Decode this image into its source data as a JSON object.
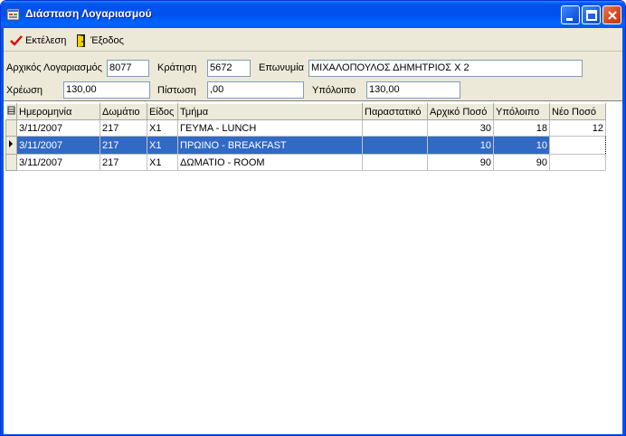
{
  "window": {
    "title": "Διάσπαση Λογαριασμού",
    "colors": {
      "title_bar": "#0054e3",
      "selection": "#316ac5",
      "face": "#ece9d8"
    }
  },
  "toolbar": {
    "execute_label": "Εκτέλεση",
    "exit_label": "Έξοδος"
  },
  "form": {
    "account_label": "Αρχικός Λογαριασμός",
    "account_value": "8077",
    "reservation_label": "Κράτηση",
    "reservation_value": "5672",
    "name_label": "Επωνυμία",
    "name_value": "ΜΙΧΑΛΟΠΟΥΛΟΣ ΔΗΜΗΤΡΙΟΣ Χ 2",
    "debit_label": "Χρέωση",
    "debit_value": "130,00",
    "credit_label": "Πίστωση",
    "credit_value": ",00",
    "balance_label": "Υπόλοιπο",
    "balance_value": "130,00"
  },
  "grid": {
    "columns": [
      "Ημερομηνία",
      "Δωμάτιο",
      "Είδος",
      "Τμήμα",
      "Παραστατικό",
      "Αρχικό Ποσό",
      "Υπόλοιπο",
      "Νέο Ποσό"
    ],
    "rows": [
      {
        "date": "3/11/2007",
        "room": "217",
        "type": "X1",
        "dept": "ΓΕΥΜΑ - LUNCH",
        "doc": "",
        "orig": "30",
        "bal": "18",
        "new": "12"
      },
      {
        "date": "3/11/2007",
        "room": "217",
        "type": "X1",
        "dept": "ΠΡΩΙΝΟ - BREAKFAST",
        "doc": "",
        "orig": "10",
        "bal": "10",
        "new": ""
      },
      {
        "date": "3/11/2007",
        "room": "217",
        "type": "X1",
        "dept": "ΔΩΜΑΤΙΟ - ROOM",
        "doc": "",
        "orig": "90",
        "bal": "90",
        "new": ""
      }
    ]
  }
}
